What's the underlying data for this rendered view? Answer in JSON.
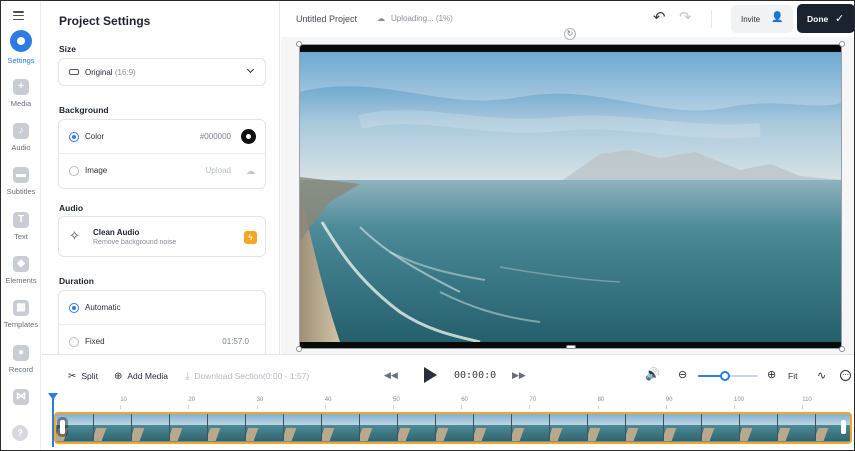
{
  "rail": {
    "items": [
      {
        "label": "Settings",
        "icon": "settings-icon",
        "active": true
      },
      {
        "label": "Media",
        "icon": "plus-square-icon"
      },
      {
        "label": "Audio",
        "icon": "music-note-icon"
      },
      {
        "label": "Subtitles",
        "icon": "subtitles-icon"
      },
      {
        "label": "Text",
        "icon": "text-icon"
      },
      {
        "label": "Elements",
        "icon": "shapes-icon"
      },
      {
        "label": "Templates",
        "icon": "templates-icon"
      },
      {
        "label": "Record",
        "icon": "record-icon"
      },
      {
        "label": "",
        "icon": "transitions-icon"
      }
    ]
  },
  "panel": {
    "title": "Project Settings",
    "size": {
      "label": "Size",
      "value": "Original",
      "sub": "(16:9)"
    },
    "background": {
      "label": "Background",
      "color_option": "Color",
      "color_value": "#000000",
      "image_option": "Image",
      "upload_label": "Upload"
    },
    "audio": {
      "label": "Audio",
      "title": "Clean Audio",
      "sub": "Remove background noise"
    },
    "duration": {
      "label": "Duration",
      "auto_option": "Automatic",
      "fixed_option": "Fixed",
      "fixed_value": "01:57.0"
    }
  },
  "topbar": {
    "project_name": "Untitled Project",
    "status": "Uploading... (1%)",
    "invite_label": "Invite",
    "done_label": "Done"
  },
  "transport": {
    "split_label": "Split",
    "add_media_label": "Add Media",
    "download_label": "Download Section(0:00 - 1:57)",
    "timecode": "00:00:0",
    "fit_label": "Fit",
    "zoom_level": 0.45
  },
  "timeline": {
    "ticks": [
      "0",
      "10",
      "20",
      "30",
      "40",
      "50",
      "60",
      "70",
      "80",
      "90",
      "100",
      "110"
    ]
  },
  "colors": {
    "accent": "#2d7be5",
    "track_border": "#f5a623",
    "done_bg": "#1b2230"
  }
}
